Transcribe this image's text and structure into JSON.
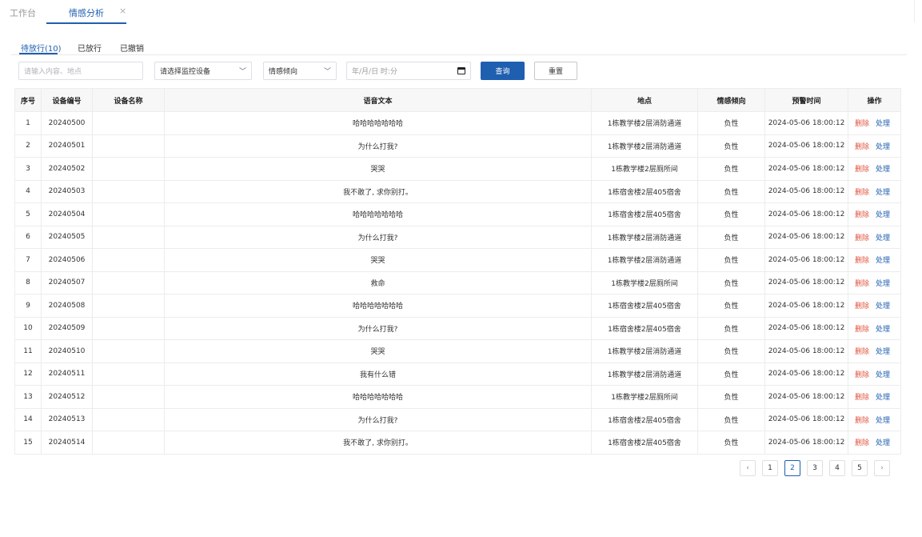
{
  "tabs": {
    "home": "工作台",
    "emotion": "情感分析",
    "close": "×"
  },
  "subtabs": [
    "待放行(10)",
    "已放行",
    "已撤销"
  ],
  "filters": {
    "keyword_placeholder": "请输入内容、地点",
    "device_placeholder": "请选择监控设备",
    "emotion_placeholder": "情感倾向",
    "datetime_placeholder": "年/月/日 时:分"
  },
  "buttons": {
    "query": "查询",
    "reset": "重置"
  },
  "table": {
    "headers": [
      "序号",
      "设备编号",
      "设备名称",
      "语音文本",
      "地点",
      "情感倾向",
      "预警时间",
      "操作"
    ],
    "delete_label": "删除",
    "handle_label": "处理",
    "rows": [
      {
        "no": "1",
        "device_id": "20240500",
        "device_name": "",
        "text": "哈哈哈哈哈哈哈",
        "location": "1栋教学楼2层消防通道",
        "emotion": "负性",
        "time": "2024-05-06 18:00:12"
      },
      {
        "no": "2",
        "device_id": "20240501",
        "device_name": "",
        "text": "为什么打我?",
        "location": "1栋教学楼2层消防通道",
        "emotion": "负性",
        "time": "2024-05-06 18:00:12"
      },
      {
        "no": "3",
        "device_id": "20240502",
        "device_name": "",
        "text": "哭哭",
        "location": "1栋教学楼2层厕所间",
        "emotion": "负性",
        "time": "2024-05-06 18:00:12"
      },
      {
        "no": "4",
        "device_id": "20240503",
        "device_name": "",
        "text": "我不敢了, 求你别打。",
        "location": "1栋宿舍楼2层405宿舍",
        "emotion": "负性",
        "time": "2024-05-06 18:00:12"
      },
      {
        "no": "5",
        "device_id": "20240504",
        "device_name": "",
        "text": "哈哈哈哈哈哈哈",
        "location": "1栋宿舍楼2层405宿舍",
        "emotion": "负性",
        "time": "2024-05-06 18:00:12"
      },
      {
        "no": "6",
        "device_id": "20240505",
        "device_name": "",
        "text": "为什么打我?",
        "location": "1栋教学楼2层消防通道",
        "emotion": "负性",
        "time": "2024-05-06 18:00:12"
      },
      {
        "no": "7",
        "device_id": "20240506",
        "device_name": "",
        "text": "哭哭",
        "location": "1栋教学楼2层消防通道",
        "emotion": "负性",
        "time": "2024-05-06 18:00:12"
      },
      {
        "no": "8",
        "device_id": "20240507",
        "device_name": "",
        "text": "救命",
        "location": "1栋教学楼2层厕所间",
        "emotion": "负性",
        "time": "2024-05-06 18:00:12"
      },
      {
        "no": "9",
        "device_id": "20240508",
        "device_name": "",
        "text": "哈哈哈哈哈哈哈",
        "location": "1栋宿舍楼2层405宿舍",
        "emotion": "负性",
        "time": "2024-05-06 18:00:12"
      },
      {
        "no": "10",
        "device_id": "20240509",
        "device_name": "",
        "text": "为什么打我?",
        "location": "1栋宿舍楼2层405宿舍",
        "emotion": "负性",
        "time": "2024-05-06 18:00:12"
      },
      {
        "no": "11",
        "device_id": "20240510",
        "device_name": "",
        "text": "哭哭",
        "location": "1栋教学楼2层消防通道",
        "emotion": "负性",
        "time": "2024-05-06 18:00:12"
      },
      {
        "no": "12",
        "device_id": "20240511",
        "device_name": "",
        "text": "我有什么错",
        "location": "1栋教学楼2层消防通道",
        "emotion": "负性",
        "time": "2024-05-06 18:00:12"
      },
      {
        "no": "13",
        "device_id": "20240512",
        "device_name": "",
        "text": "哈哈哈哈哈哈哈",
        "location": "1栋教学楼2层厕所间",
        "emotion": "负性",
        "time": "2024-05-06 18:00:12"
      },
      {
        "no": "14",
        "device_id": "20240513",
        "device_name": "",
        "text": "为什么打我?",
        "location": "1栋宿舍楼2层405宿舍",
        "emotion": "负性",
        "time": "2024-05-06 18:00:12"
      },
      {
        "no": "15",
        "device_id": "20240514",
        "device_name": "",
        "text": "我不敢了, 求你别打。",
        "location": "1栋宿舍楼2层405宿舍",
        "emotion": "负性",
        "time": "2024-05-06 18:00:12"
      }
    ]
  },
  "pagination": {
    "prev": "‹",
    "next": "›",
    "pages": [
      "1",
      "2",
      "3",
      "4",
      "5"
    ],
    "current": "2"
  },
  "colors": {
    "primary": "#1f5fb0",
    "danger": "#e2533c"
  }
}
